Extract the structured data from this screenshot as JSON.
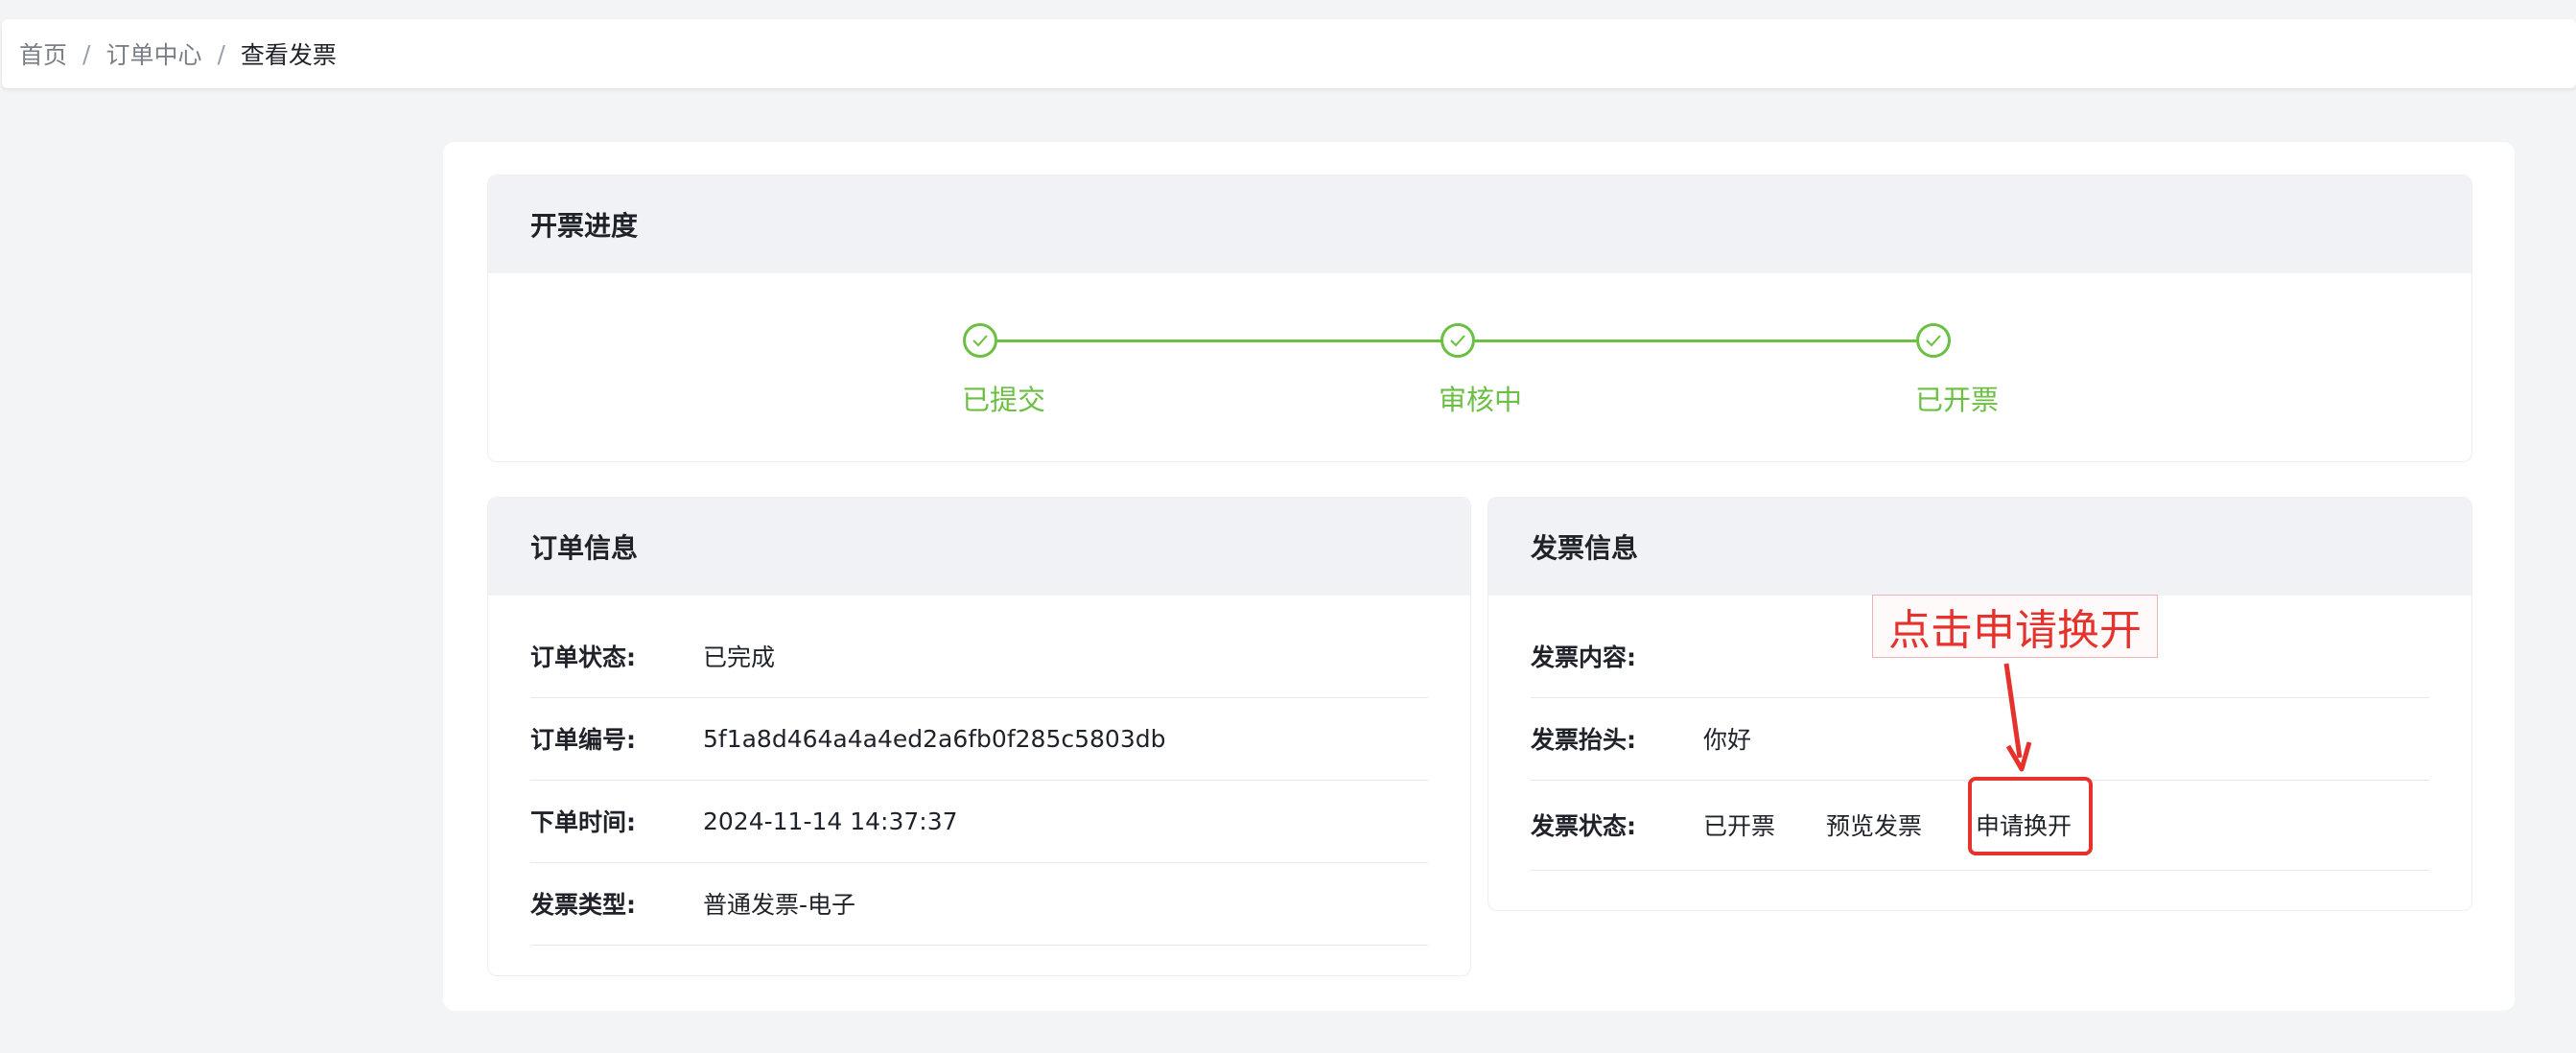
{
  "breadcrumb": {
    "items": [
      "首页",
      "订单中心",
      "查看发票"
    ],
    "separator": "/"
  },
  "progress": {
    "title": "开票进度",
    "steps": [
      {
        "label": "已提交",
        "done": true
      },
      {
        "label": "审核中",
        "done": true
      },
      {
        "label": "已开票",
        "done": true
      }
    ]
  },
  "order": {
    "title": "订单信息",
    "rows": [
      {
        "label": "订单状态:",
        "value": "已完成"
      },
      {
        "label": "订单编号:",
        "value": "5f1a8d464a4a4ed2a6fb0f285c5803db"
      },
      {
        "label": "下单时间:",
        "value": "2024-11-14 14:37:37"
      },
      {
        "label": "发票类型:",
        "value": "普通发票-电子"
      }
    ]
  },
  "invoice": {
    "title": "发票信息",
    "content_label": "发票内容:",
    "content_value": "",
    "header_label": "发票抬头:",
    "header_value": "你好",
    "status_label": "发票状态:",
    "status_value": "已开票",
    "preview_link": "预览发票",
    "reissue_link": "申请换开"
  },
  "annotation": {
    "text": "点击申请换开"
  },
  "colors": {
    "success": "#6bbf42",
    "link": "#2e7be8",
    "annotation": "#e5322d"
  }
}
